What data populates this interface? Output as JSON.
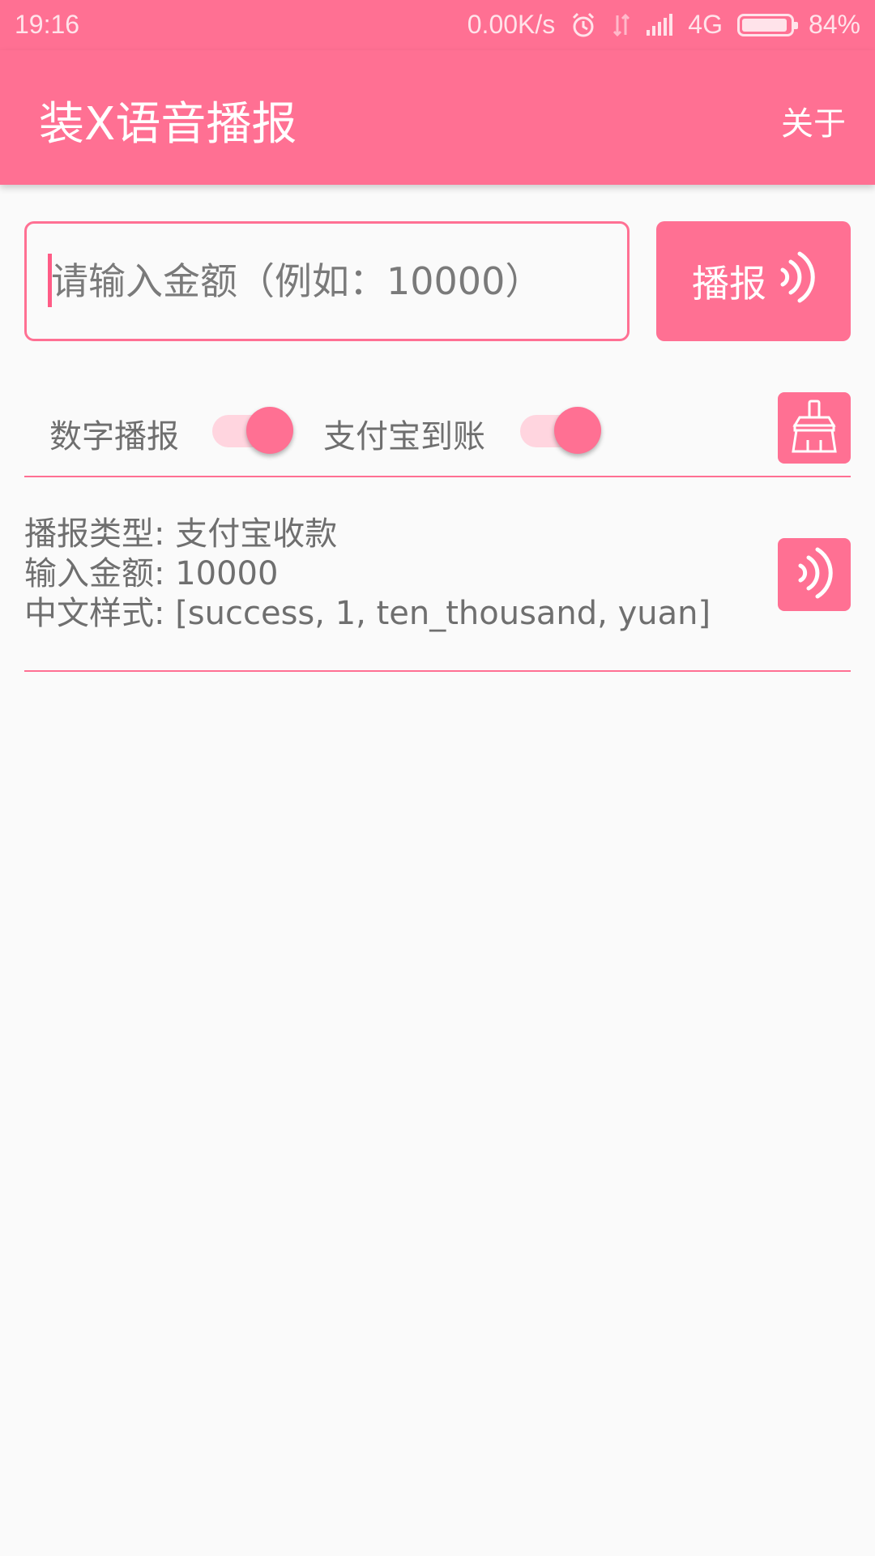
{
  "status_bar": {
    "time": "19:16",
    "net_speed": "0.00K/s",
    "network": "4G",
    "battery": "84%",
    "battery_level": 0.84,
    "icons": [
      "alarm-icon",
      "data-transfer-icon",
      "signal-icon",
      "battery-icon"
    ]
  },
  "app_bar": {
    "title": "装X语音播报",
    "about_label": "关于"
  },
  "input": {
    "value": "",
    "placeholder": "请输入金额（例如：10000）"
  },
  "play_button": {
    "label": "播报",
    "icon": "sound-wave-icon"
  },
  "switches": [
    {
      "label": "数字播报",
      "on": true
    },
    {
      "label": "支付宝到账",
      "on": true
    }
  ],
  "clear_button": {
    "icon": "broom-icon"
  },
  "result": {
    "type_line": "播报类型: 支付宝收款",
    "amount_line": "输入金额: 10000",
    "style_line": "中文样式: [success, 1, ten_thousand, yuan]"
  },
  "replay_button": {
    "icon": "sound-wave-icon"
  },
  "colors": {
    "primary": "#ff7093",
    "background": "#fafafa",
    "text": "#6f6f6f",
    "switch_track": "#ffd5df"
  }
}
